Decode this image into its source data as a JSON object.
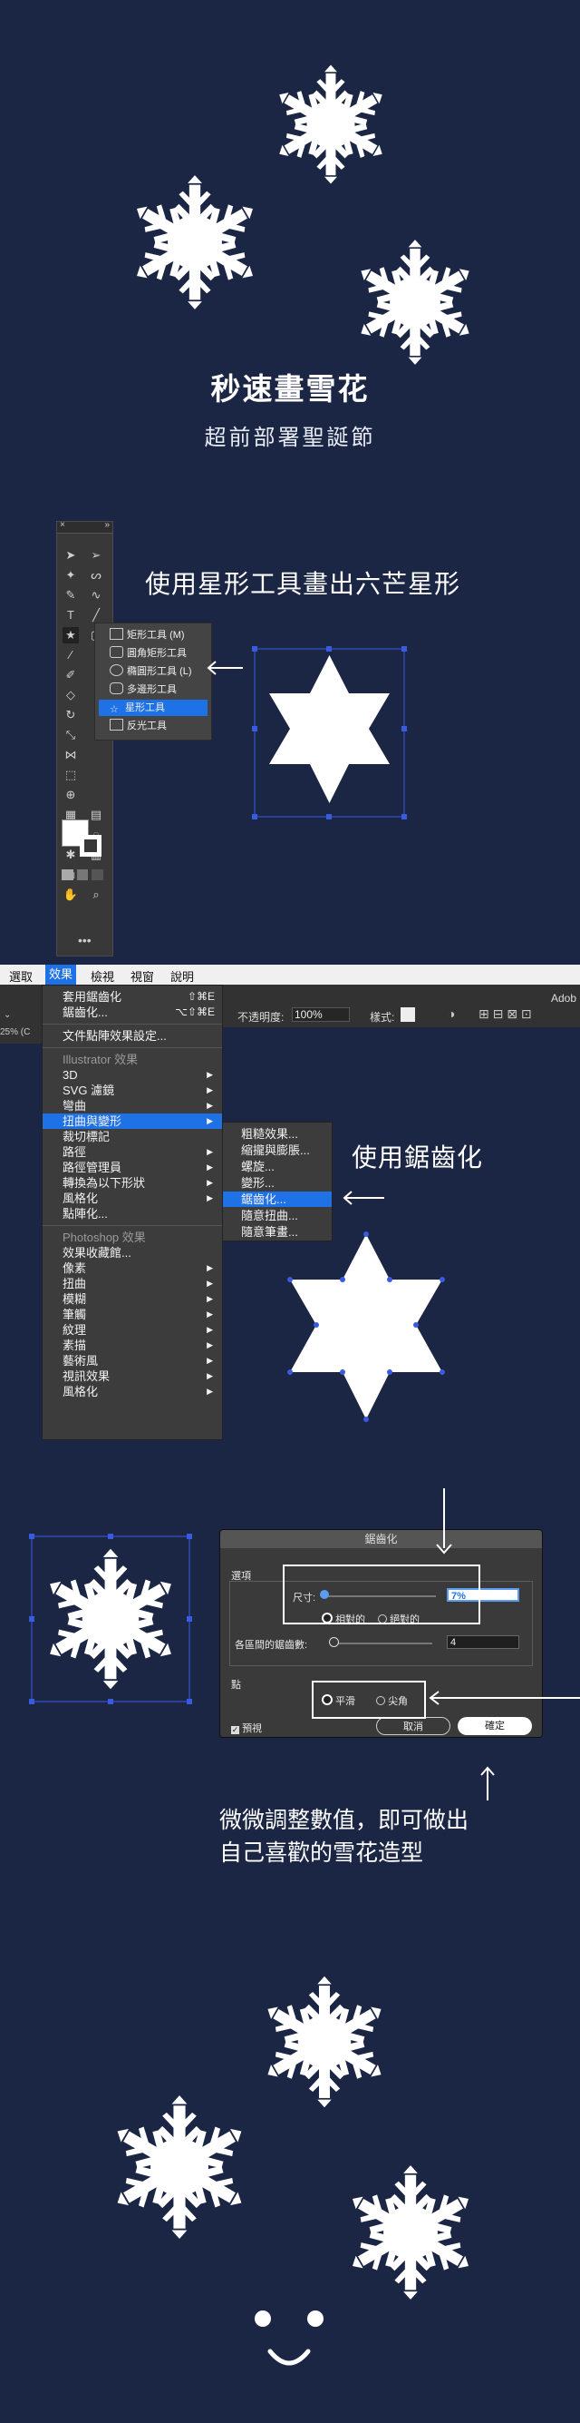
{
  "hero": {
    "title": "秒速畫雪花",
    "subtitle": "超前部署聖誕節"
  },
  "step1": {
    "heading": "使用星形工具畫出六芒星形",
    "flyout_items": [
      {
        "label": "矩形工具",
        "shortcut": "(M)"
      },
      {
        "label": "圓角矩形工具",
        "shortcut": ""
      },
      {
        "label": "橢圓形工具",
        "shortcut": "(L)"
      },
      {
        "label": "多邊形工具",
        "shortcut": ""
      },
      {
        "label": "星形工具",
        "shortcut": ""
      },
      {
        "label": "反光工具",
        "shortcut": ""
      }
    ],
    "selected_tool": "星形工具"
  },
  "step2": {
    "heading": "使用鋸齒化",
    "menubar": [
      "選取",
      "效果",
      "檢視",
      "視窗",
      "說明"
    ],
    "active_menu": "效果",
    "app_name": "Adob",
    "opacity_label": "不透明度:",
    "opacity_value": "100%",
    "style_label": "樣式:",
    "zoom_label": "25% (C",
    "menu_top": [
      {
        "label": "套用鋸齒化",
        "shortcut": "⇧⌘E"
      },
      {
        "label": "鋸齒化...",
        "shortcut": "⌥⇧⌘E"
      }
    ],
    "menu_doc": "文件點陣效果設定...",
    "illustrator_header": "Illustrator 效果",
    "illustrator_items": [
      {
        "label": "3D",
        "arrow": true
      },
      {
        "label": "SVG 濾鏡",
        "arrow": true
      },
      {
        "label": "彎曲",
        "arrow": true
      },
      {
        "label": "扭曲與變形",
        "arrow": true
      },
      {
        "label": "裁切標記",
        "arrow": false
      },
      {
        "label": "路徑",
        "arrow": true
      },
      {
        "label": "路徑管理員",
        "arrow": true
      },
      {
        "label": "轉換為以下形狀",
        "arrow": true
      },
      {
        "label": "風格化",
        "arrow": true
      },
      {
        "label": "點陣化...",
        "arrow": false
      }
    ],
    "photoshop_header": "Photoshop 效果",
    "photoshop_items": [
      {
        "label": "效果收藏館...",
        "arrow": false
      },
      {
        "label": "像素",
        "arrow": true
      },
      {
        "label": "扭曲",
        "arrow": true
      },
      {
        "label": "模糊",
        "arrow": true
      },
      {
        "label": "筆觸",
        "arrow": true
      },
      {
        "label": "紋理",
        "arrow": true
      },
      {
        "label": "素描",
        "arrow": true
      },
      {
        "label": "藝術風",
        "arrow": true
      },
      {
        "label": "視訊效果",
        "arrow": true
      },
      {
        "label": "風格化",
        "arrow": true
      }
    ],
    "submenu_items": [
      "粗糙效果...",
      "縮攏與膨脹...",
      "螺旋...",
      "變形...",
      "鋸齒化...",
      "隨意扭曲...",
      "隨意筆畫..."
    ],
    "submenu_selected": "鋸齒化..."
  },
  "step3": {
    "dialog_title": "鋸齒化",
    "options_label": "選項",
    "size_label": "尺寸:",
    "size_value": "7%",
    "relative_label": "相對的",
    "absolute_label": "絕對的",
    "ridges_label": "各區間的鋸齒數:",
    "ridges_value": "4",
    "points_label": "點",
    "smooth_label": "平滑",
    "corner_label": "尖角",
    "preview_label": "預視",
    "cancel_label": "取消",
    "ok_label": "確定",
    "note_line1": "微微調整數值，即可做出",
    "note_line2": "自己喜歡的雪花造型"
  },
  "colors": {
    "background": "#1b2544",
    "accent": "#1f72e6",
    "snow": "#ffffff"
  }
}
